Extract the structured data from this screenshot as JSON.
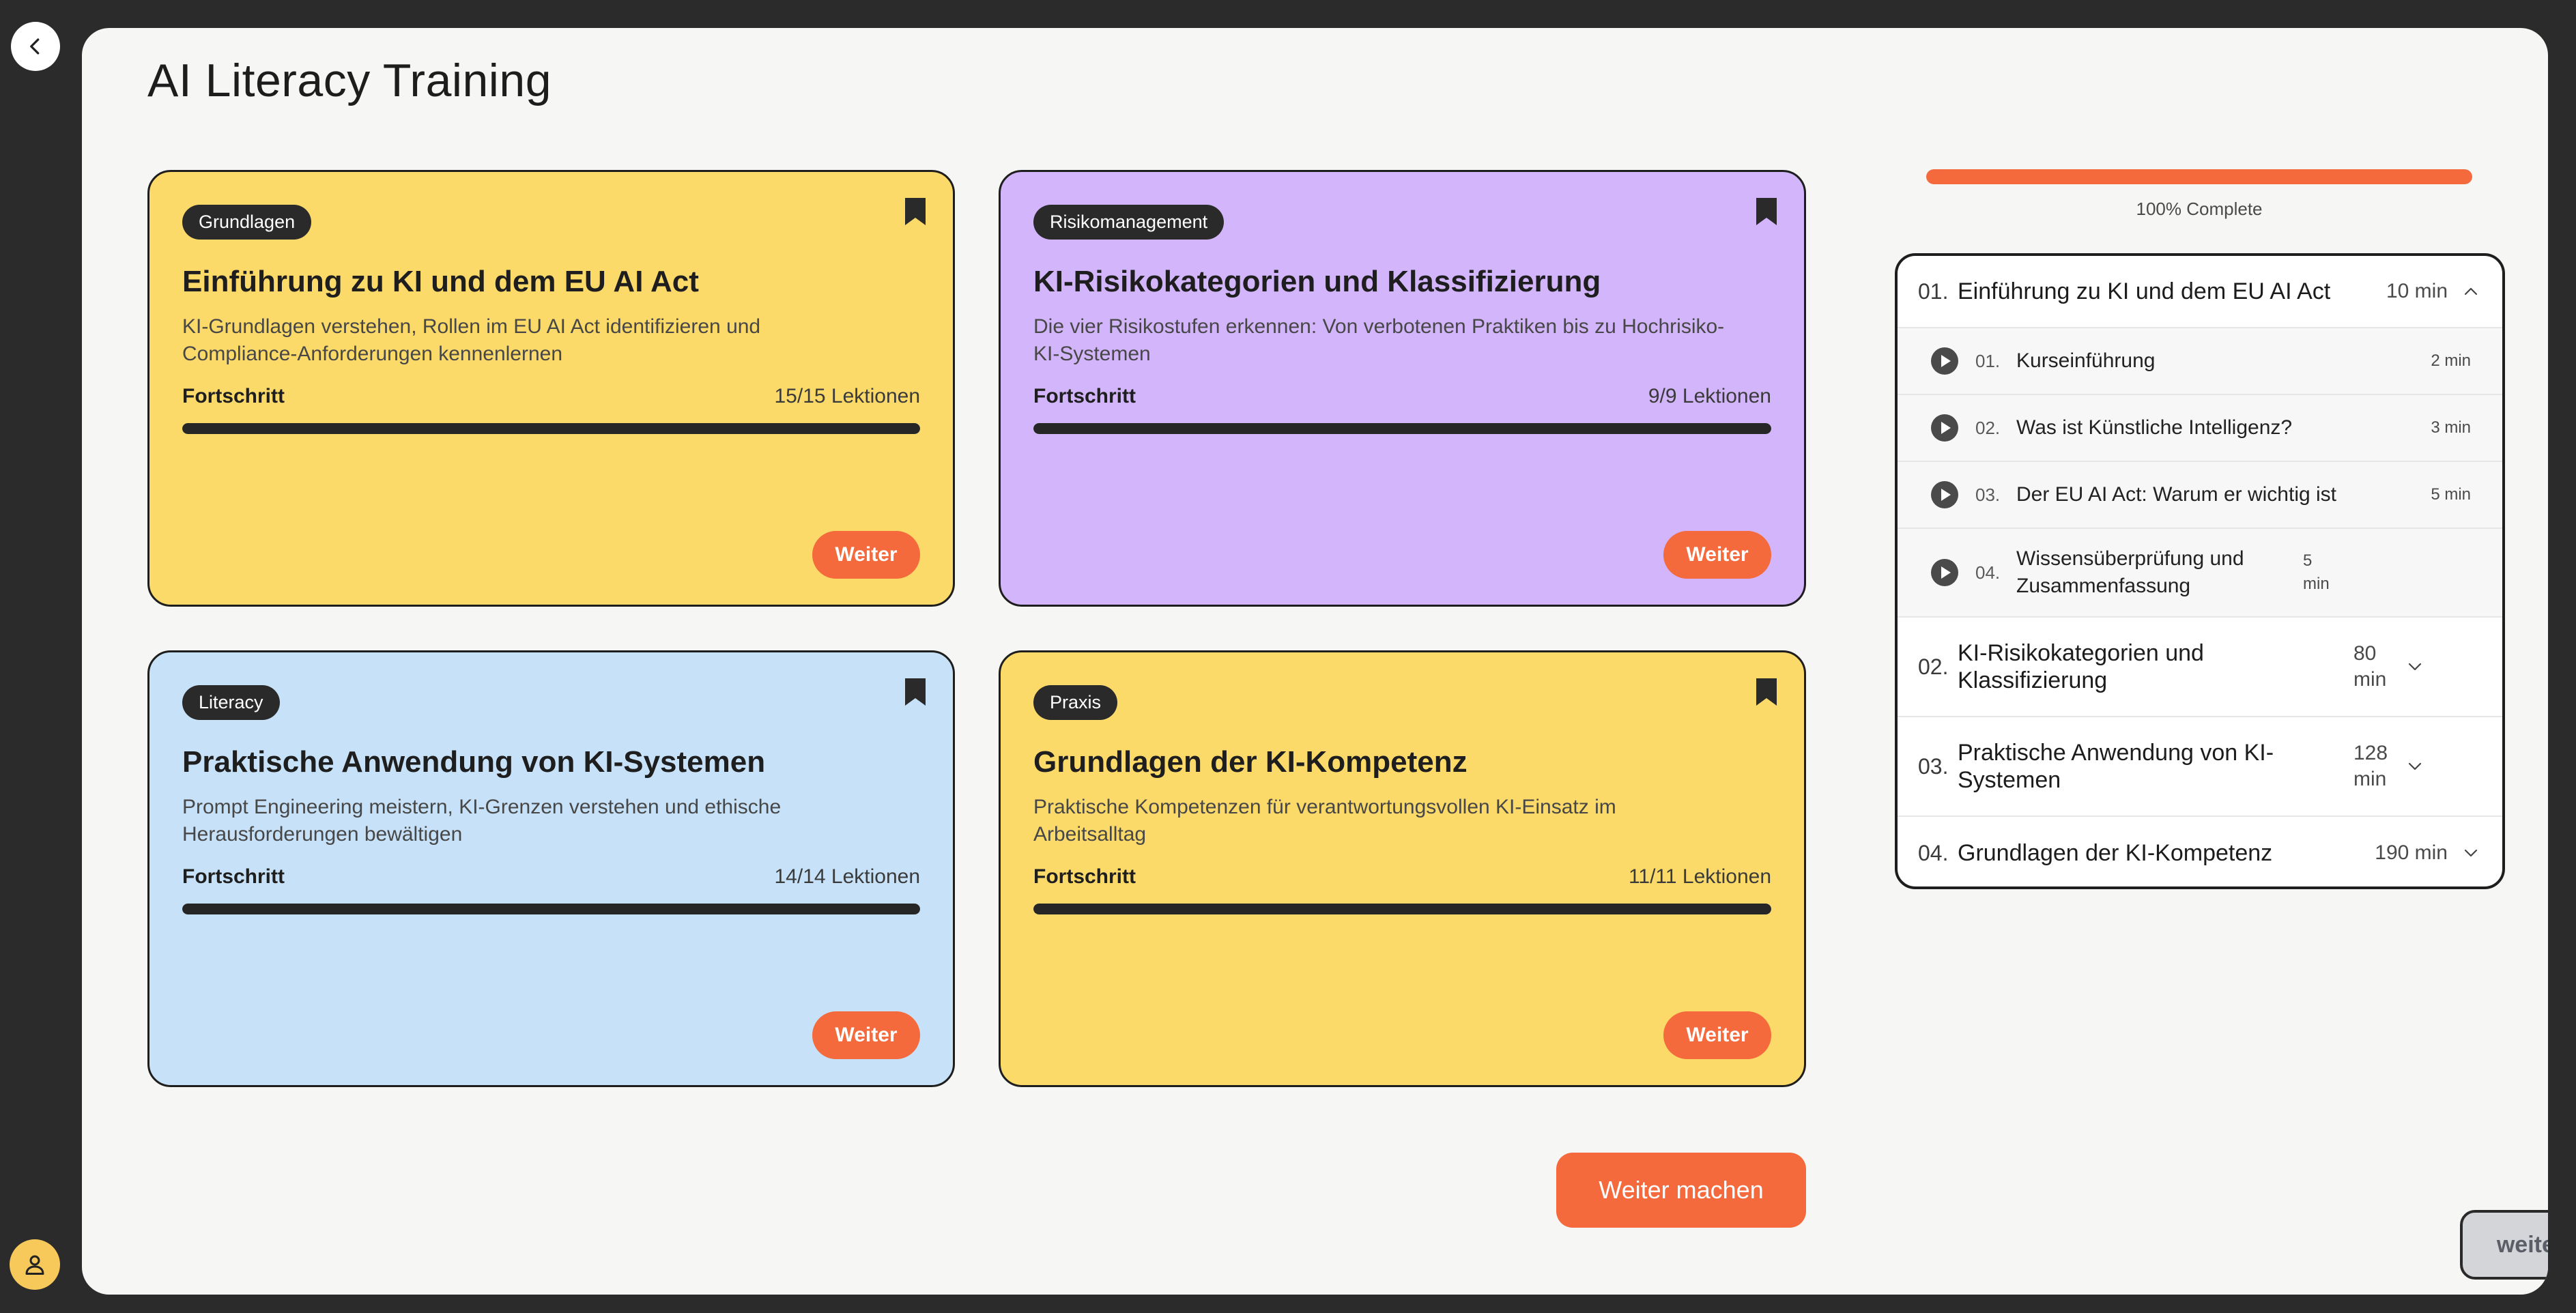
{
  "page": {
    "title": "AI Literacy Training"
  },
  "courses": [
    {
      "badge": "Grundlagen",
      "title": "Einführung zu KI und dem EU AI Act",
      "description": "KI-Grundlagen verstehen, Rollen im EU AI Act identifizieren und Compliance-Anforderungen kennenlernen",
      "progress_label": "Fortschritt",
      "progress_count": "15/15 Lektionen",
      "progress_fraction": 1.0,
      "button": "Weiter",
      "color": "#fcda6a"
    },
    {
      "badge": "Risikomanagement",
      "title": "KI-Risikokategorien und Klassifizierung",
      "description": "Die vier Risikostufen erkennen: Von verbotenen Praktiken bis zu Hochrisiko-KI-Systemen",
      "progress_label": "Fortschritt",
      "progress_count": "9/9 Lektionen",
      "progress_fraction": 1.0,
      "button": "Weiter",
      "color": "#d3b5fb"
    },
    {
      "badge": "Literacy",
      "title": "Praktische Anwendung von KI-Systemen",
      "description": "Prompt Engineering meistern, KI-Grenzen verstehen und ethische Herausforderungen bewältigen",
      "progress_label": "Fortschritt",
      "progress_count": "14/14 Lektionen",
      "progress_fraction": 1.0,
      "button": "Weiter",
      "color": "#c7e2f8"
    },
    {
      "badge": "Praxis",
      "title": "Grundlagen der KI-Kompetenz",
      "description": "Praktische Kompetenzen für verantwortungsvollen KI-Einsatz im Arbeitsalltag",
      "progress_label": "Fortschritt",
      "progress_count": "11/11 Lektionen",
      "progress_fraction": 1.0,
      "button": "Weiter",
      "color": "#fcda6a"
    }
  ],
  "main_button": "Weiter machen",
  "overall_progress": {
    "label": "100% Complete",
    "fraction": 1.0
  },
  "curriculum": {
    "modules": [
      {
        "number": "01.",
        "title": "Einführung zu KI und dem EU AI Act",
        "duration": "10 min",
        "expanded": true,
        "lessons": [
          {
            "number": "01.",
            "title": "Kurseinführung",
            "duration": "2 min"
          },
          {
            "number": "02.",
            "title": "Was ist Künstliche Intelligenz?",
            "duration": "3 min"
          },
          {
            "number": "03.",
            "title": "Der EU AI Act: Warum er wichtig ist",
            "duration": "5 min"
          },
          {
            "number": "04.",
            "title": "Wissensüberprüfung und Zusammenfassung",
            "duration": "5 min"
          }
        ]
      },
      {
        "number": "02.",
        "title": "KI-Risikokategorien und Klassifizierung",
        "duration": "80 min",
        "expanded": false
      },
      {
        "number": "03.",
        "title": "Praktische Anwendung von KI-Systemen",
        "duration": "128 min",
        "expanded": false
      },
      {
        "number": "04.",
        "title": "Grundlagen der KI-Kompetenz",
        "duration": "190 min",
        "expanded": false
      }
    ]
  },
  "floating_button": "weiter",
  "colors": {
    "accent": "#f46a3c",
    "dark": "#2b2b2b",
    "panel": "#f6f6f4"
  },
  "icons": {
    "back": "chevron-left-icon",
    "user": "user-icon",
    "bookmark": "bookmark-icon",
    "play": "play-circle-icon",
    "chevron_up": "chevron-up-icon",
    "chevron_down": "chevron-down-icon"
  }
}
